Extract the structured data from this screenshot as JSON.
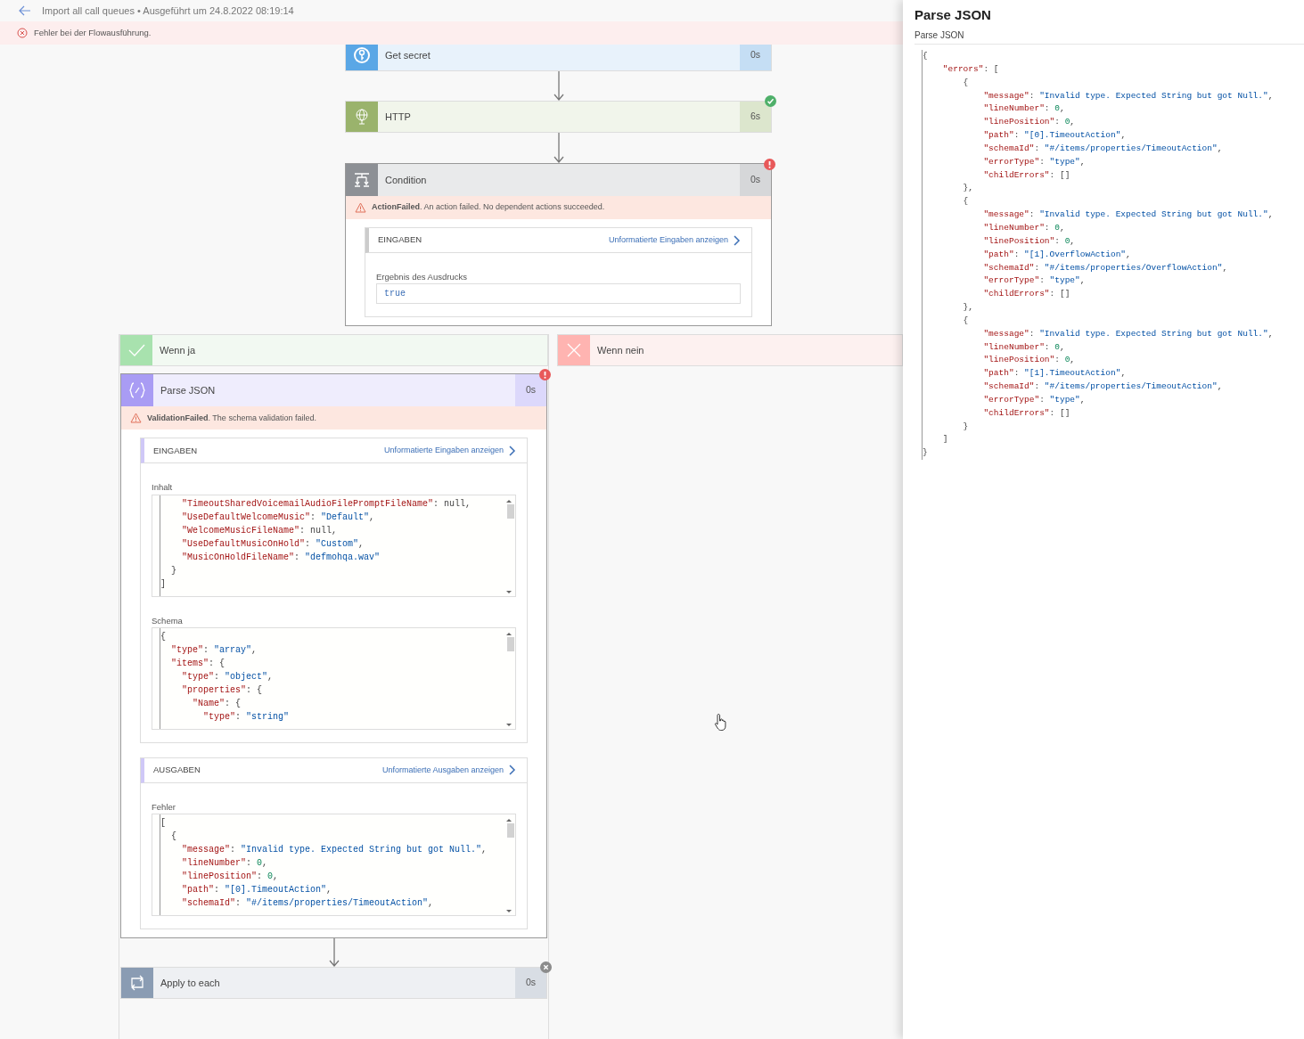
{
  "header": {
    "title": "Import all call queues • Ausgeführt um 24.8.2022 08:19:14"
  },
  "banner": {
    "text": "Fehler bei der Flowausführung."
  },
  "flow": [
    {
      "kind": "keyvault",
      "title": "Get secret",
      "duration": "0s"
    },
    {
      "kind": "http",
      "title": "HTTP",
      "duration": "6s",
      "status": {
        "kind": "succeeded"
      }
    },
    {
      "kind": "condition",
      "title": "Condition",
      "duration": "0s",
      "status": {
        "kind": "failed"
      },
      "error": "**ActionFailed**. An action failed. No dependent actions succeeded.",
      "sections": [
        {
          "heading": "EINGABEN",
          "link": "Unformatierte Eingaben anzeigen",
          "fields": [
            {
              "label": "Ergebnis des Ausdrucks",
              "kind": "value",
              "value": "true"
            }
          ]
        }
      ],
      "branches": [
        {
          "kind": "yes",
          "label": "Wenn ja",
          "actions": [
            {
              "kind": "json",
              "title": "Parse JSON",
              "duration": "0s",
              "status": {
                "kind": "failed"
              },
              "error": "**ValidationFailed**. The schema validation failed.",
              "sections": [
                {
                  "heading": "EINGABEN",
                  "link": "Unformatierte Eingaben anzeigen",
                  "fields": [
                    {
                      "label": "Inhalt",
                      "kind": "code",
                      "lines": [
                        "    \"TimeoutSharedVoicemailAudioFilePromptFileName\": null,",
                        "    \"UseDefaultWelcomeMusic\": \"Default\",",
                        "    \"WelcomeMusicFileName\": null,",
                        "    \"UseDefaultMusicOnHold\": \"Custom\",",
                        "    \"MusicOnHoldFileName\": \"defmohqa.wav\"",
                        "  }",
                        "]"
                      ]
                    },
                    {
                      "label": "Schema",
                      "kind": "code",
                      "lines": [
                        "{",
                        "  \"type\": \"array\",",
                        "  \"items\": {",
                        "    \"type\": \"object\",",
                        "    \"properties\": {",
                        "      \"Name\": {",
                        "        \"type\": \"string\""
                      ]
                    }
                  ]
                },
                {
                  "heading": "AUSGABEN",
                  "link": "Unformatierte Ausgaben anzeigen",
                  "fields": [
                    {
                      "label": "Fehler",
                      "kind": "code",
                      "lines": [
                        "[",
                        "  {",
                        "    \"message\": \"Invalid type. Expected String but got Null.\",",
                        "    \"lineNumber\": 0,",
                        "    \"linePosition\": 0,",
                        "    \"path\": \"[0].TimeoutAction\",",
                        "    \"schemaId\": \"#/items/properties/TimeoutAction\","
                      ]
                    }
                  ]
                }
              ]
            },
            {
              "kind": "foreach",
              "title": "Apply to each",
              "duration": "0s",
              "status": {
                "kind": "cancelled"
              }
            }
          ]
        },
        {
          "kind": "no",
          "label": "Wenn nein"
        }
      ]
    }
  ],
  "panel": {
    "title": "Parse JSON",
    "subtitle": "Parse JSON",
    "lines": [
      "{",
      "    \"errors\": [",
      "        {",
      "            \"message\": \"Invalid type. Expected String but got Null.\",",
      "            \"lineNumber\": 0,",
      "            \"linePosition\": 0,",
      "            \"path\": \"[0].TimeoutAction\",",
      "            \"schemaId\": \"#/items/properties/TimeoutAction\",",
      "            \"errorType\": \"type\",",
      "            \"childErrors\": []",
      "        },",
      "        {",
      "            \"message\": \"Invalid type. Expected String but got Null.\",",
      "            \"lineNumber\": 0,",
      "            \"linePosition\": 0,",
      "            \"path\": \"[1].OverflowAction\",",
      "            \"schemaId\": \"#/items/properties/OverflowAction\",",
      "            \"errorType\": \"type\",",
      "            \"childErrors\": []",
      "        },",
      "        {",
      "            \"message\": \"Invalid type. Expected String but got Null.\",",
      "            \"lineNumber\": 0,",
      "            \"linePosition\": 0,",
      "            \"path\": \"[1].TimeoutAction\",",
      "            \"schemaId\": \"#/items/properties/TimeoutAction\",",
      "            \"errorType\": \"type\",",
      "            \"childErrors\": []",
      "        }",
      "    ]",
      "}"
    ]
  }
}
